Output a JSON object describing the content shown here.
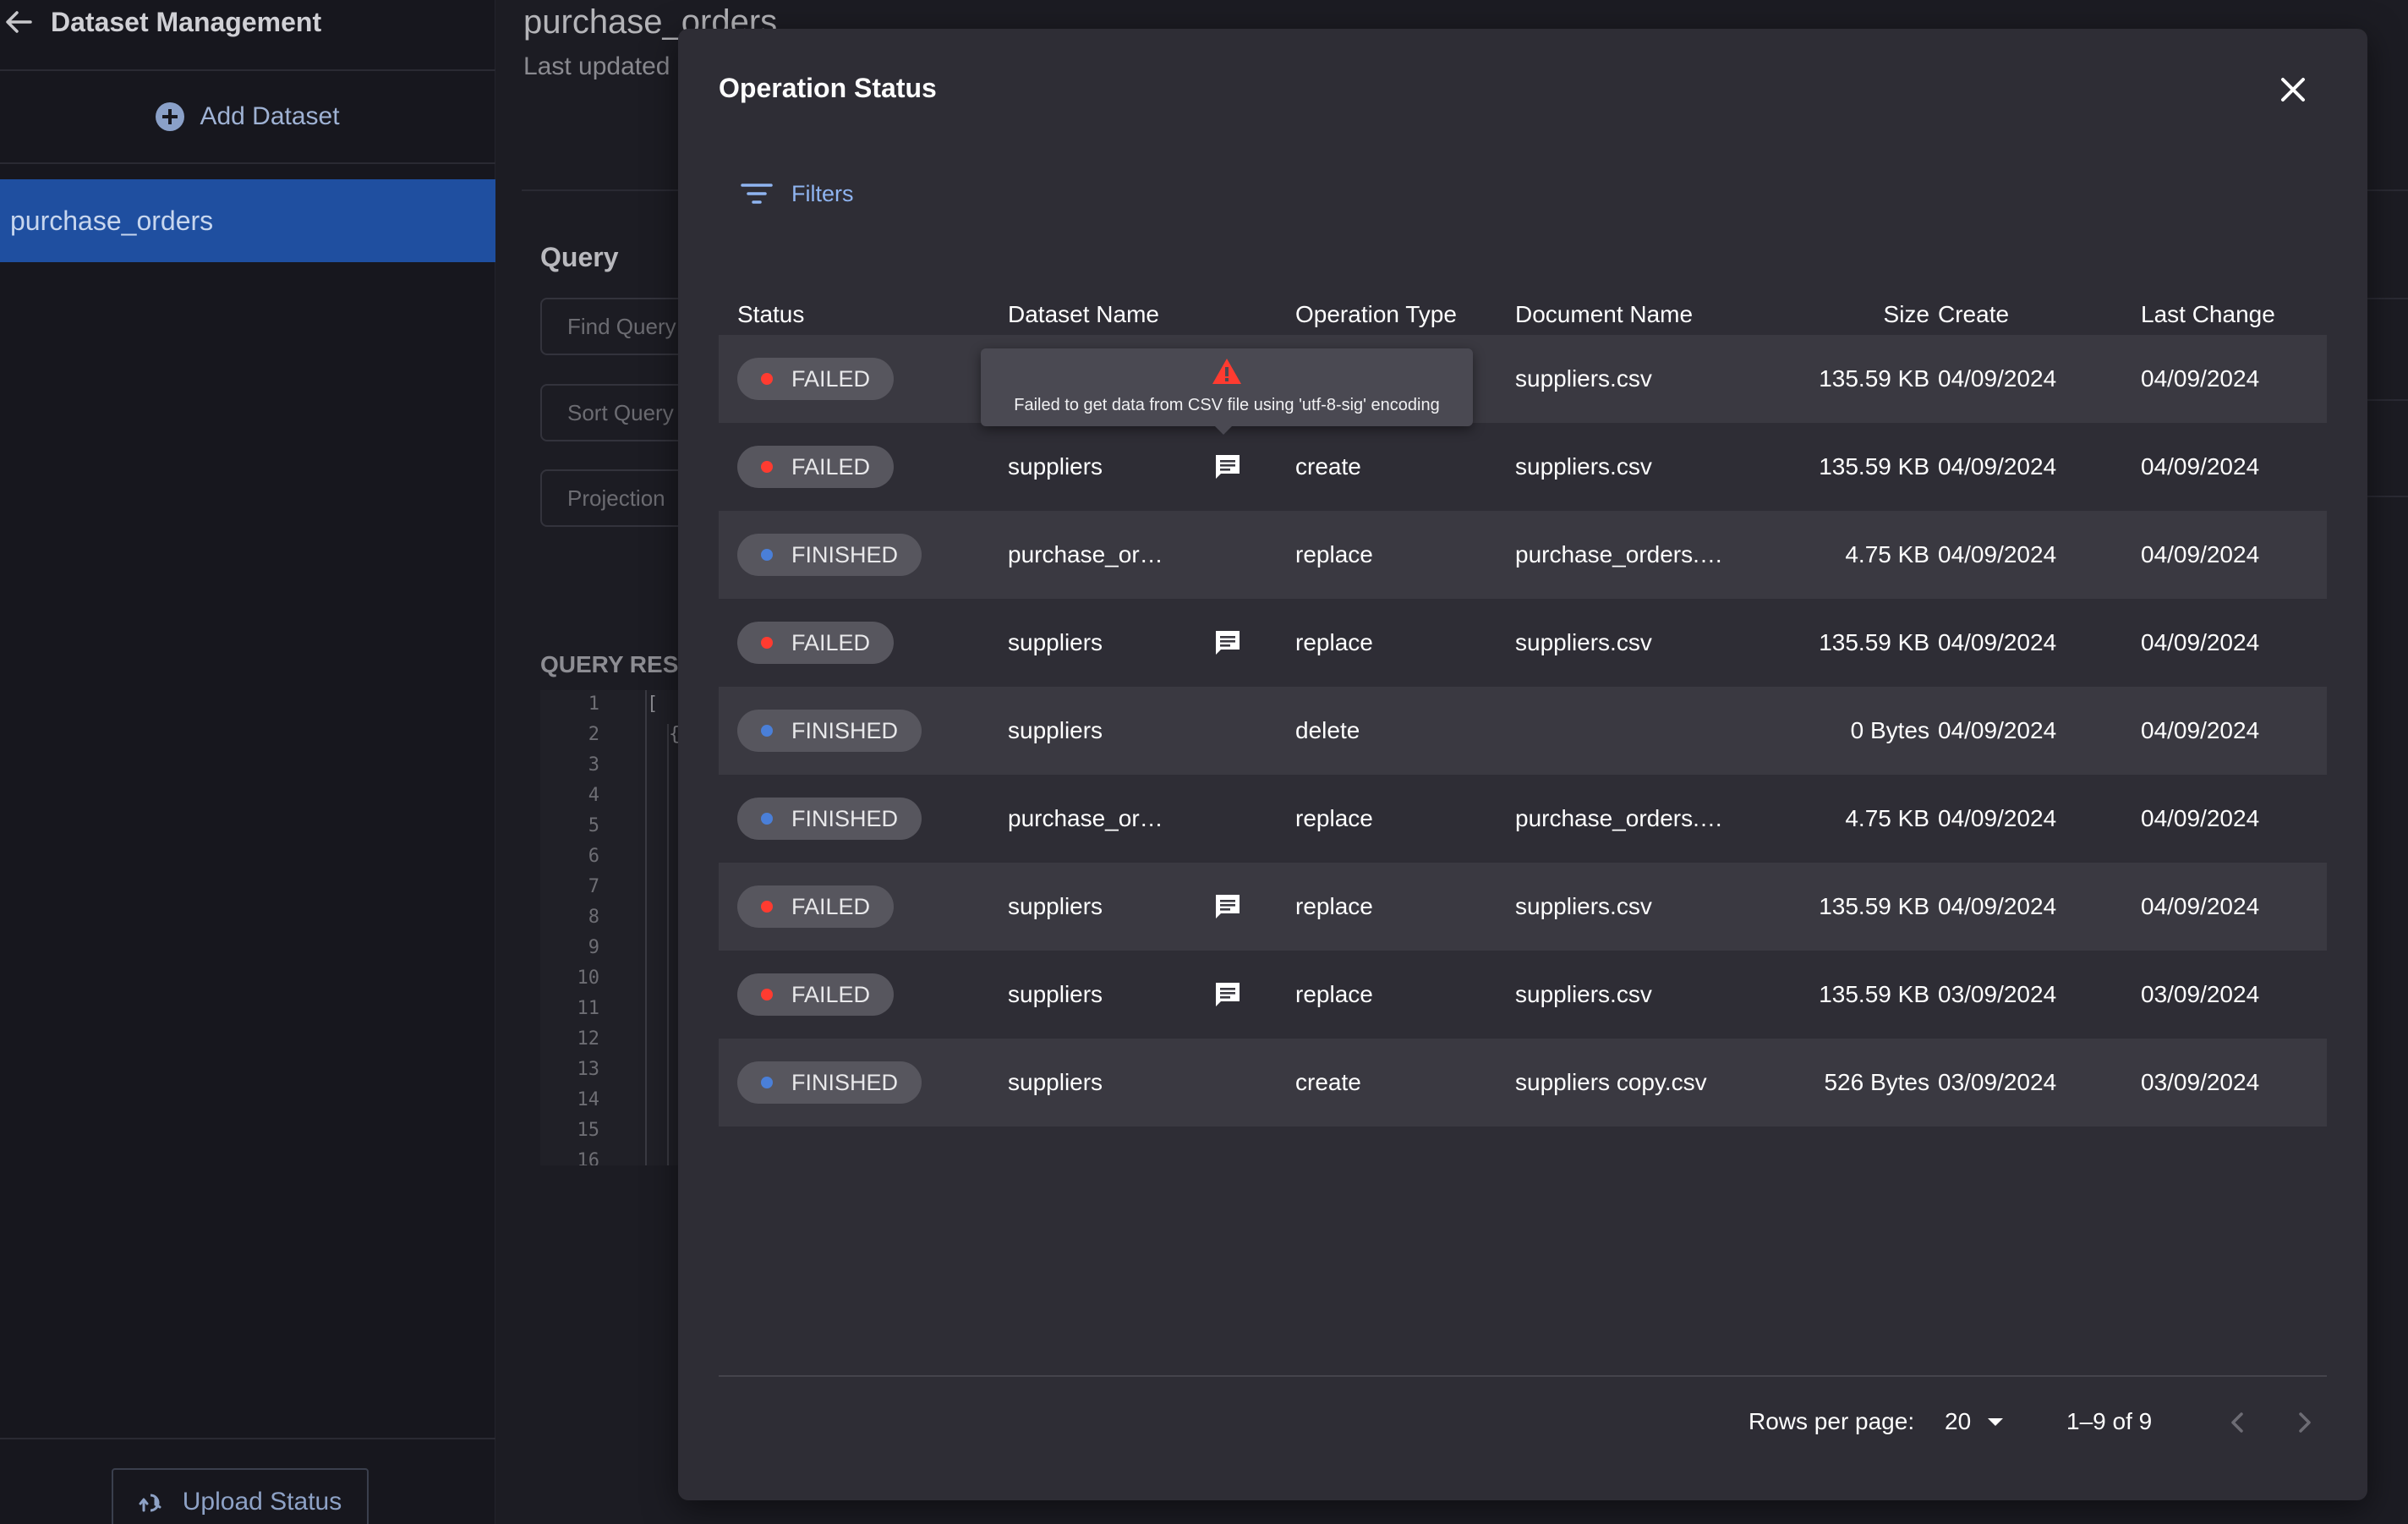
{
  "sidebar": {
    "title": "Dataset Management",
    "add_label": "Add Dataset",
    "active_item": "purchase_orders",
    "upload_label": "Upload Status"
  },
  "main": {
    "title": "purchase_orders",
    "subtitle": "Last updated",
    "query_label": "Query",
    "fields": [
      "Find Query",
      "Sort Query",
      "Projection"
    ],
    "results_label": "QUERY RES",
    "line_numbers": [
      "1",
      "2",
      "3",
      "4",
      "5",
      "6",
      "7",
      "8",
      "9",
      "10",
      "11",
      "12",
      "13",
      "14",
      "15",
      "16"
    ],
    "code_line1": "[",
    "code_line2": "{"
  },
  "modal": {
    "title": "Operation Status",
    "filters_label": "Filters",
    "columns": {
      "status": "Status",
      "dataset": "Dataset Name",
      "operation": "Operation Type",
      "document": "Document Name",
      "size": "Size",
      "create": "Create",
      "last_change": "Last Change"
    },
    "rows": [
      {
        "status": "FAILED",
        "dataset": "",
        "operation": "",
        "document": "suppliers.csv",
        "size": "135.59 KB",
        "create": "04/09/2024",
        "last_change": "04/09/2024",
        "has_message": false
      },
      {
        "status": "FAILED",
        "dataset": "suppliers",
        "operation": "create",
        "document": "suppliers.csv",
        "size": "135.59 KB",
        "create": "04/09/2024",
        "last_change": "04/09/2024",
        "has_message": true
      },
      {
        "status": "FINISHED",
        "dataset": "purchase_or…",
        "operation": "replace",
        "document": "purchase_orders.…",
        "size": "4.75 KB",
        "create": "04/09/2024",
        "last_change": "04/09/2024",
        "has_message": false
      },
      {
        "status": "FAILED",
        "dataset": "suppliers",
        "operation": "replace",
        "document": "suppliers.csv",
        "size": "135.59 KB",
        "create": "04/09/2024",
        "last_change": "04/09/2024",
        "has_message": true
      },
      {
        "status": "FINISHED",
        "dataset": "suppliers",
        "operation": "delete",
        "document": "",
        "size": "0 Bytes",
        "create": "04/09/2024",
        "last_change": "04/09/2024",
        "has_message": false
      },
      {
        "status": "FINISHED",
        "dataset": "purchase_or…",
        "operation": "replace",
        "document": "purchase_orders.…",
        "size": "4.75 KB",
        "create": "04/09/2024",
        "last_change": "04/09/2024",
        "has_message": false
      },
      {
        "status": "FAILED",
        "dataset": "suppliers",
        "operation": "replace",
        "document": "suppliers.csv",
        "size": "135.59 KB",
        "create": "04/09/2024",
        "last_change": "04/09/2024",
        "has_message": true
      },
      {
        "status": "FAILED",
        "dataset": "suppliers",
        "operation": "replace",
        "document": "suppliers.csv",
        "size": "135.59 KB",
        "create": "03/09/2024",
        "last_change": "03/09/2024",
        "has_message": true
      },
      {
        "status": "FINISHED",
        "dataset": "suppliers",
        "operation": "create",
        "document": "suppliers copy.csv",
        "size": "526 Bytes",
        "create": "03/09/2024",
        "last_change": "03/09/2024",
        "has_message": false
      }
    ],
    "tooltip": {
      "icon": "warning-icon",
      "text": "Failed to get data from CSV file using 'utf-8-sig' encoding"
    },
    "pagination": {
      "rows_per_page_label": "Rows per page:",
      "rows_per_page_value": "20",
      "range": "1–9 of 9"
    }
  },
  "colors": {
    "failed_dot": "#ff3b30",
    "finished_dot": "#4a7fd8",
    "accent": "#8fb4f0",
    "sidebar_active": "#1f4fa0",
    "warning": "#ff3b30"
  },
  "icons": {
    "back": "arrow-left-icon",
    "add": "plus-circle-icon",
    "upload": "upload-status-icon",
    "close": "close-icon",
    "filters": "filter-lines-icon",
    "message": "message-icon",
    "prev": "chevron-left-icon",
    "next": "chevron-right-icon"
  }
}
